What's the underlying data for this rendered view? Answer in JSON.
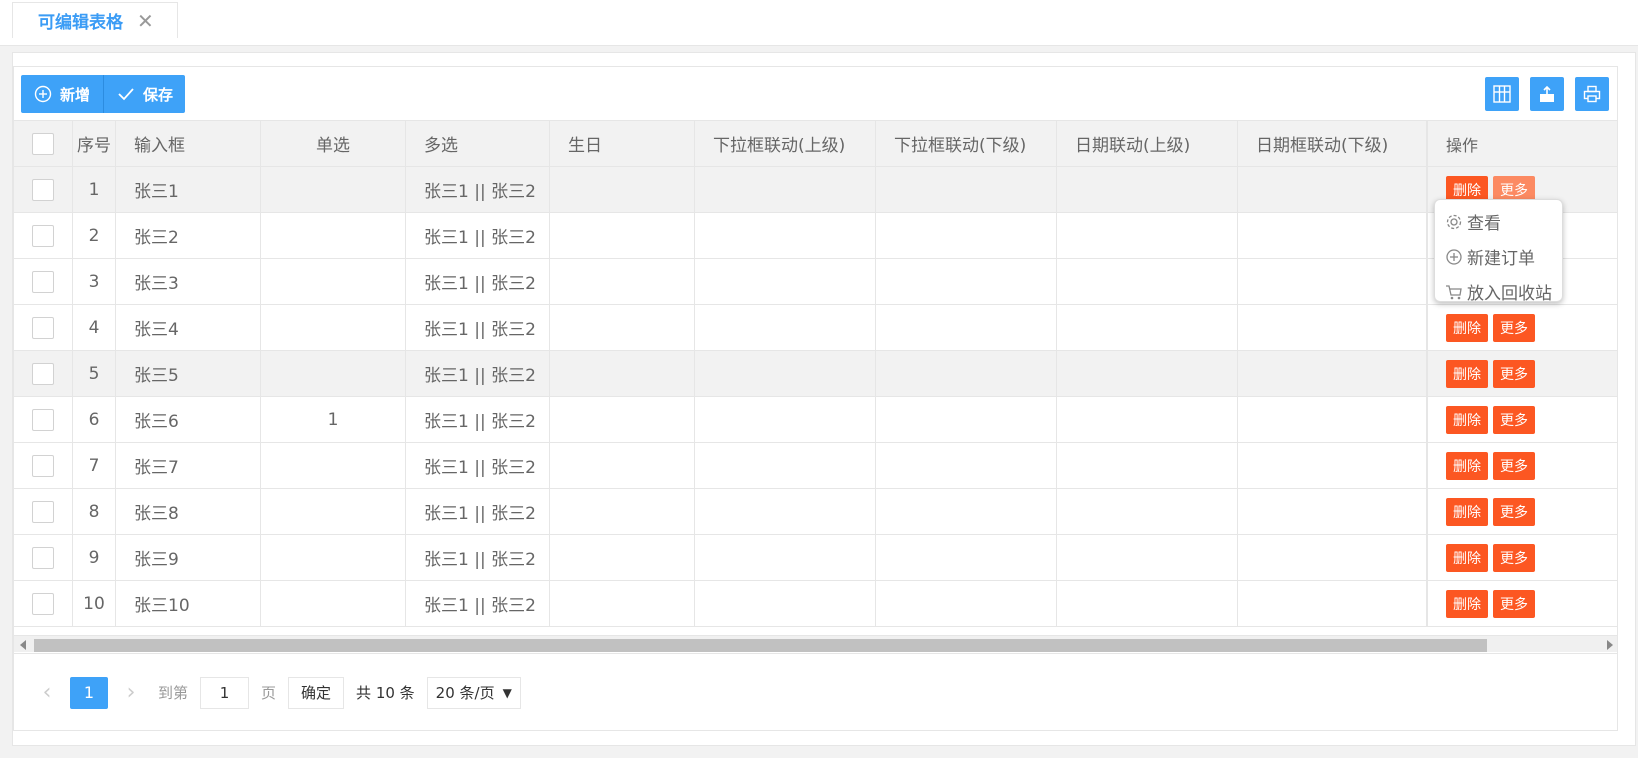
{
  "tab": {
    "title": "可编辑表格",
    "close": "✕"
  },
  "toolbar": {
    "add_label": "新增",
    "save_label": "保存",
    "right_icons": [
      "columns-icon",
      "export-icon",
      "print-icon"
    ]
  },
  "table": {
    "headers": [
      "序号",
      "输入框",
      "单选",
      "多选",
      "生日",
      "下拉框联动(上级)",
      "下拉框联动(下级)",
      "日期联动(上级)",
      "日期框联动(下级)",
      "操作"
    ],
    "rows": [
      {
        "idx": "1",
        "name": "张三1",
        "radio": "",
        "multi": "张三1 || 张三2"
      },
      {
        "idx": "2",
        "name": "张三2",
        "radio": "",
        "multi": "张三1 || 张三2"
      },
      {
        "idx": "3",
        "name": "张三3",
        "radio": "",
        "multi": "张三1 || 张三2"
      },
      {
        "idx": "4",
        "name": "张三4",
        "radio": "",
        "multi": "张三1 || 张三2"
      },
      {
        "idx": "5",
        "name": "张三5",
        "radio": "",
        "multi": "张三1 || 张三2"
      },
      {
        "idx": "6",
        "name": "张三6",
        "radio": "1",
        "multi": "张三1 || 张三2"
      },
      {
        "idx": "7",
        "name": "张三7",
        "radio": "",
        "multi": "张三1 || 张三2"
      },
      {
        "idx": "8",
        "name": "张三8",
        "radio": "",
        "multi": "张三1 || 张三2"
      },
      {
        "idx": "9",
        "name": "张三9",
        "radio": "",
        "multi": "张三1 || 张三2"
      },
      {
        "idx": "10",
        "name": "张三10",
        "radio": "",
        "multi": "张三1 || 张三2"
      }
    ],
    "delete_label": "删除",
    "more_label": "更多"
  },
  "dropdown": {
    "items": [
      "查看",
      "新建订单",
      "放入回收站"
    ]
  },
  "pager": {
    "current": "1",
    "goto_label": "到第",
    "goto_value": "1",
    "page_label": "页",
    "confirm_label": "确定",
    "total_label": "共 10 条",
    "size_label": "20 条/页"
  },
  "colors": {
    "primary": "#3ea2f8",
    "danger": "#fc5722",
    "danger_light": "#fc8a62"
  }
}
